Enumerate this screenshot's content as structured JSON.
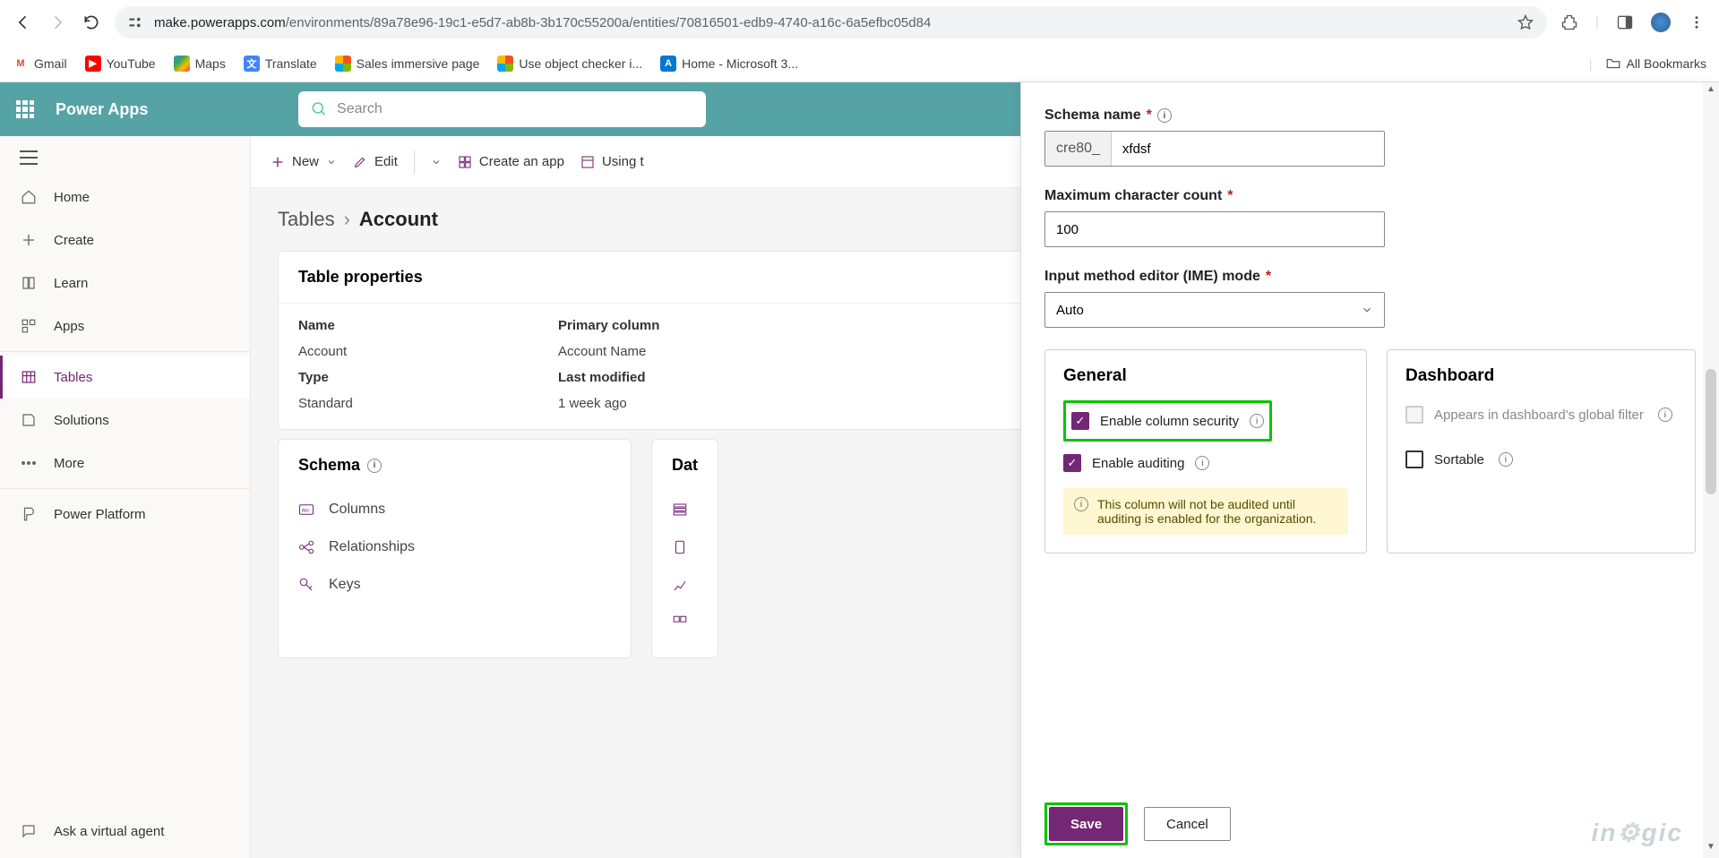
{
  "browser": {
    "url_host": "make.powerapps.com",
    "url_path": "/environments/89a78e96-19c1-e5d7-ab8b-3b170c55200a/entities/70816501-edb9-4740-a16c-6a5efbc05d84"
  },
  "bookmarks": {
    "gmail": "Gmail",
    "youtube": "YouTube",
    "maps": "Maps",
    "translate": "Translate",
    "sales": "Sales immersive page",
    "objchecker": "Use object checker i...",
    "mshome": "Home - Microsoft 3...",
    "all": "All Bookmarks"
  },
  "header": {
    "app_title": "Power Apps",
    "search_placeholder": "Search"
  },
  "nav": {
    "home": "Home",
    "create": "Create",
    "learn": "Learn",
    "apps": "Apps",
    "tables": "Tables",
    "solutions": "Solutions",
    "more": "More",
    "power_platform": "Power Platform",
    "ask_agent": "Ask a virtual agent"
  },
  "toolbar": {
    "new_label": "New",
    "edit_label": "Edit",
    "create_app_label": "Create an app",
    "using_label": "Using t"
  },
  "breadcrumbs": {
    "root": "Tables",
    "current": "Account"
  },
  "propsCard": {
    "title": "Table properties",
    "name_hdr": "Name",
    "name_val": "Account",
    "primary_hdr": "Primary column",
    "primary_val": "Account Name",
    "type_hdr": "Type",
    "type_val": "Standard",
    "lastmod_hdr": "Last modified",
    "lastmod_val": "1 week ago"
  },
  "schemaCard": {
    "title": "Schema",
    "columns": "Columns",
    "relationships": "Relationships",
    "keys": "Keys"
  },
  "dataCard": {
    "title": "Dat"
  },
  "panel": {
    "schema_label": "Schema name",
    "schema_prefix": "cre80_",
    "schema_value": "xfdsf",
    "maxchar_label": "Maximum character count",
    "maxchar_value": "100",
    "ime_label": "Input method editor (IME) mode",
    "ime_value": "Auto",
    "general_title": "General",
    "enable_col_security": "Enable column security",
    "enable_auditing": "Enable auditing",
    "audit_note": "This column will not be audited until auditing is enabled for the organization.",
    "dashboard_title": "Dashboard",
    "dashboard_filter": "Appears in dashboard's global filter",
    "sortable": "Sortable",
    "save_label": "Save",
    "cancel_label": "Cancel"
  },
  "watermark": "inogic"
}
